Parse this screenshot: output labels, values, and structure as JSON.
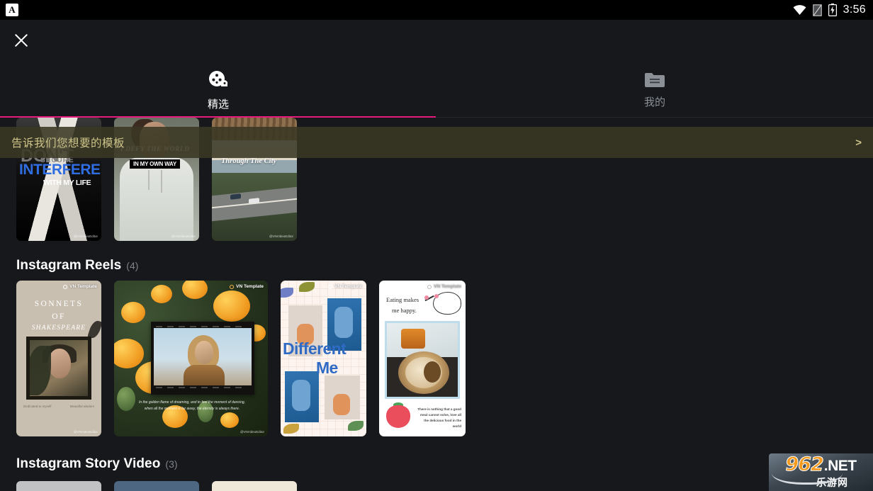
{
  "status_bar": {
    "app_icon": "A",
    "time": "3:56",
    "icons": [
      "wifi-icon",
      "sim-card-icon",
      "battery-charging-icon"
    ]
  },
  "top_bar": {
    "close_icon": "close-icon"
  },
  "tabs": [
    {
      "label": "精选",
      "icon": "film-reel-icon",
      "active": true
    },
    {
      "label": "我的",
      "icon": "folder-icon",
      "active": false
    }
  ],
  "banner": {
    "text": "告诉我们您想要的模板",
    "arrow": ">",
    "accent_color": "#cdc489",
    "background": "rgba(58,56,35,0.88)"
  },
  "accent_color": "#e8197d",
  "featured_row": {
    "cards": [
      {
        "name": "dont-interfere",
        "line1": "DON'T",
        "line2": "INTERFERE",
        "line3": "WITH MY LIFE",
        "secure": "SECURE",
        "credit": "@VNVideoEditor"
      },
      {
        "name": "i-defy-the-world",
        "line1": "I DEFY THE WORLD",
        "line2": "IN MY OWN WAY",
        "credit": "@VNVideoEditor"
      },
      {
        "name": "through-the-city",
        "line1": "Through The City",
        "credit": "@VNVideoEditor"
      }
    ]
  },
  "sections": [
    {
      "title": "Instagram Reels",
      "count": "(4)",
      "cards": [
        {
          "name": "sonnets-of-shakespeare",
          "badge": "VN Template",
          "line1": "SONNETS",
          "line2": "OF",
          "line3": "SHAKESPEARE",
          "caption_left": "Dedicated to myself",
          "caption_right": "Beautiful wisdom",
          "credit": "@VNVideoEditor"
        },
        {
          "name": "marigold-flowers",
          "badge": "VN Template",
          "quote": "In the golden flame of dreaming, and to feel the moment of dancing, when all the moment is far away, the eternity is always there.",
          "credit": "@VNVideoEditor"
        },
        {
          "name": "different-me",
          "badge": "VN Template",
          "line1": "Different",
          "line2": "Me"
        },
        {
          "name": "eating-makes-me-happy",
          "badge": "VN Template",
          "line1": "Eating makes",
          "line2": "me happy.",
          "quote": "There is nothing that a good meal cannot solve, love all the delicious food in the world"
        }
      ]
    },
    {
      "title": "Instagram Story Video",
      "count": "(3)",
      "cards": [
        {
          "name": "story-card-1"
        },
        {
          "name": "story-card-2"
        },
        {
          "name": "story-card-3"
        }
      ]
    }
  ],
  "watermark": {
    "number": "962",
    "net": ".NET",
    "chinese": "乐游网"
  }
}
